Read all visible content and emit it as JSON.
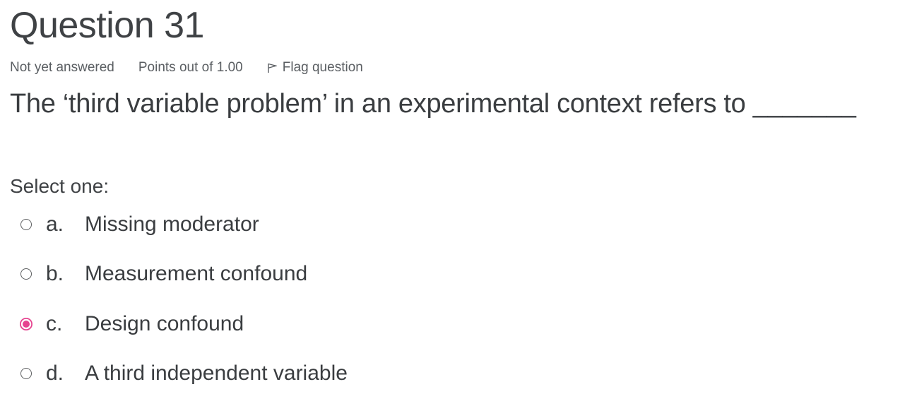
{
  "question": {
    "title_prefix": "Question",
    "number": "31",
    "state": "Not yet answered",
    "grade": "Points out of 1.00",
    "flag_label": "Flag question",
    "text": "The ‘third variable problem’ in an experimental context refers to _______",
    "prompt": "Select one:"
  },
  "answers": [
    {
      "letter": "a.",
      "text": "Missing moderator",
      "selected": false
    },
    {
      "letter": "b.",
      "text": "Measurement confound",
      "selected": false
    },
    {
      "letter": "c.",
      "text": "Design confound",
      "selected": true
    },
    {
      "letter": "d.",
      "text": "A third independent variable",
      "selected": false
    }
  ],
  "colors": {
    "selected_radio": "#e6438f",
    "text": "#3a3d40",
    "meta_text": "#5a5e62"
  },
  "icons": {
    "flag": "flag-icon"
  }
}
